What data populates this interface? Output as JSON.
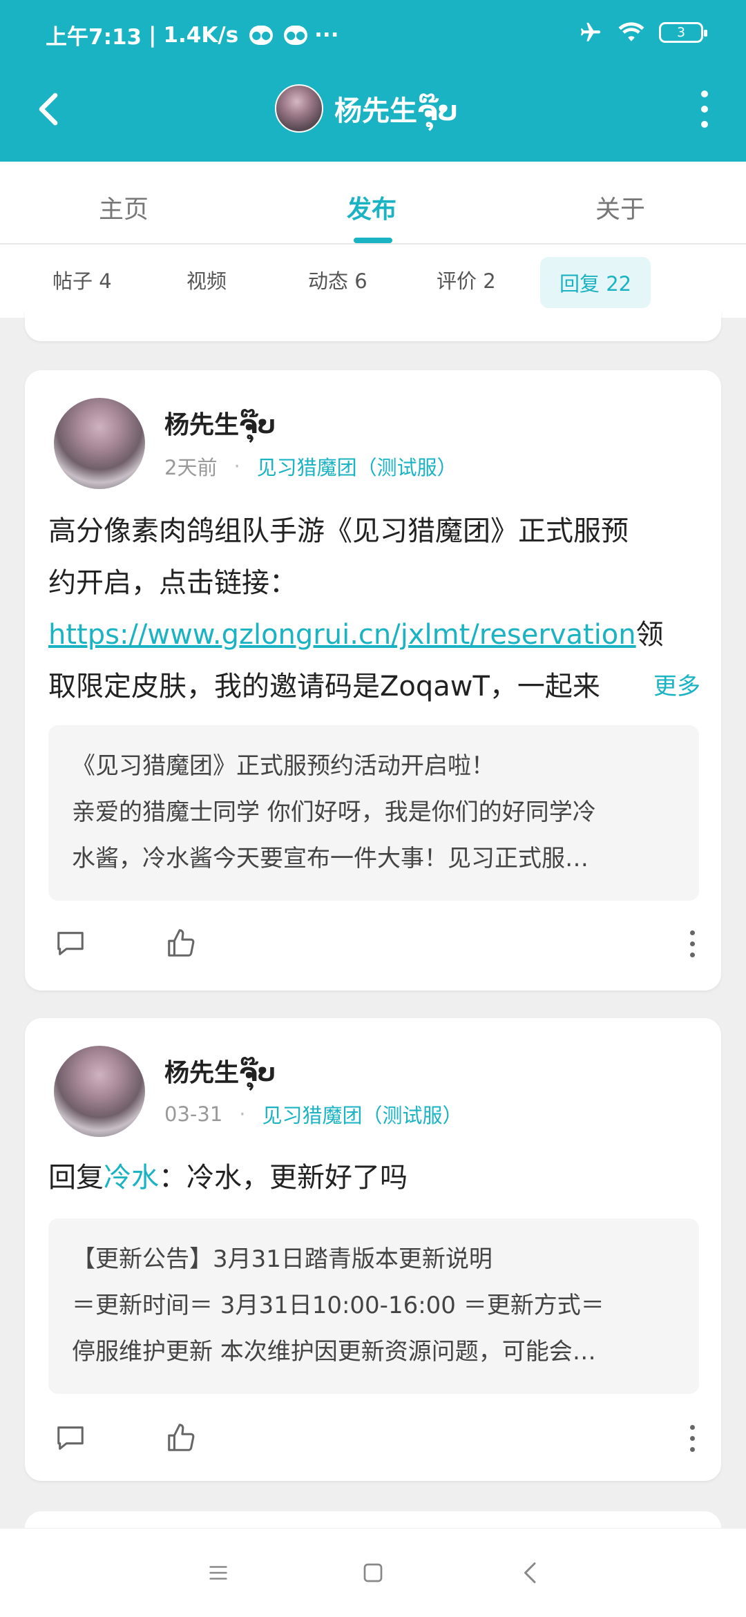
{
  "status_bar": {
    "time": "上午7:13",
    "speed": "1.4K/s",
    "ellipsis": "···",
    "battery": "3"
  },
  "header": {
    "title": "杨先生ຈຸ໊ບ"
  },
  "tabs": [
    {
      "label": "主页",
      "active": false
    },
    {
      "label": "发布",
      "active": true
    },
    {
      "label": "关于",
      "active": false
    }
  ],
  "subtabs": [
    {
      "label": "帖子 4",
      "active": false
    },
    {
      "label": "视频",
      "active": false
    },
    {
      "label": "动态 6",
      "active": false
    },
    {
      "label": "评价 2",
      "active": false
    },
    {
      "label": "回复 22",
      "active": true
    }
  ],
  "posts": [
    {
      "author": "杨先生ຈຸ໊ບ",
      "time": "2天前",
      "separator": "·",
      "game": "见习猎魔团（测试服）",
      "text_line1": "高分像素肉鸽组队手游《见习猎魔团》正式服预",
      "text_line2": "约开启，点击链接：",
      "link": "https://www.gzlongrui.cn/jxlmt/reservation",
      "text_after_link": "领",
      "text_line4": "取限定皮肤，我的邀请码是ZoqawT，一起来",
      "more": "更多",
      "quote_lines": [
        "《见习猎魔团》正式服预约活动开启啦！",
        "亲爱的猎魔士同学 你们好呀，我是你们的好同学冷",
        "水酱，冷水酱今天要宣布一件大事！见习正式服…"
      ]
    },
    {
      "author": "杨先生ຈຸ໊ບ",
      "time": "03-31",
      "separator": "·",
      "game": "见习猎魔团（测试服）",
      "reply_prefix": "回复",
      "reply_to": "冷水",
      "reply_text": "：冷水，更新好了吗",
      "quote_lines": [
        "【更新公告】3月31日踏青版本更新说明",
        "＝更新时间＝ 3月31日10:00-16:00 ＝更新方式＝",
        "停服维护更新 本次维护因更新资源问题，可能会…"
      ]
    }
  ],
  "colors": {
    "accent": "#1ab3c3",
    "background": "#efefef"
  }
}
